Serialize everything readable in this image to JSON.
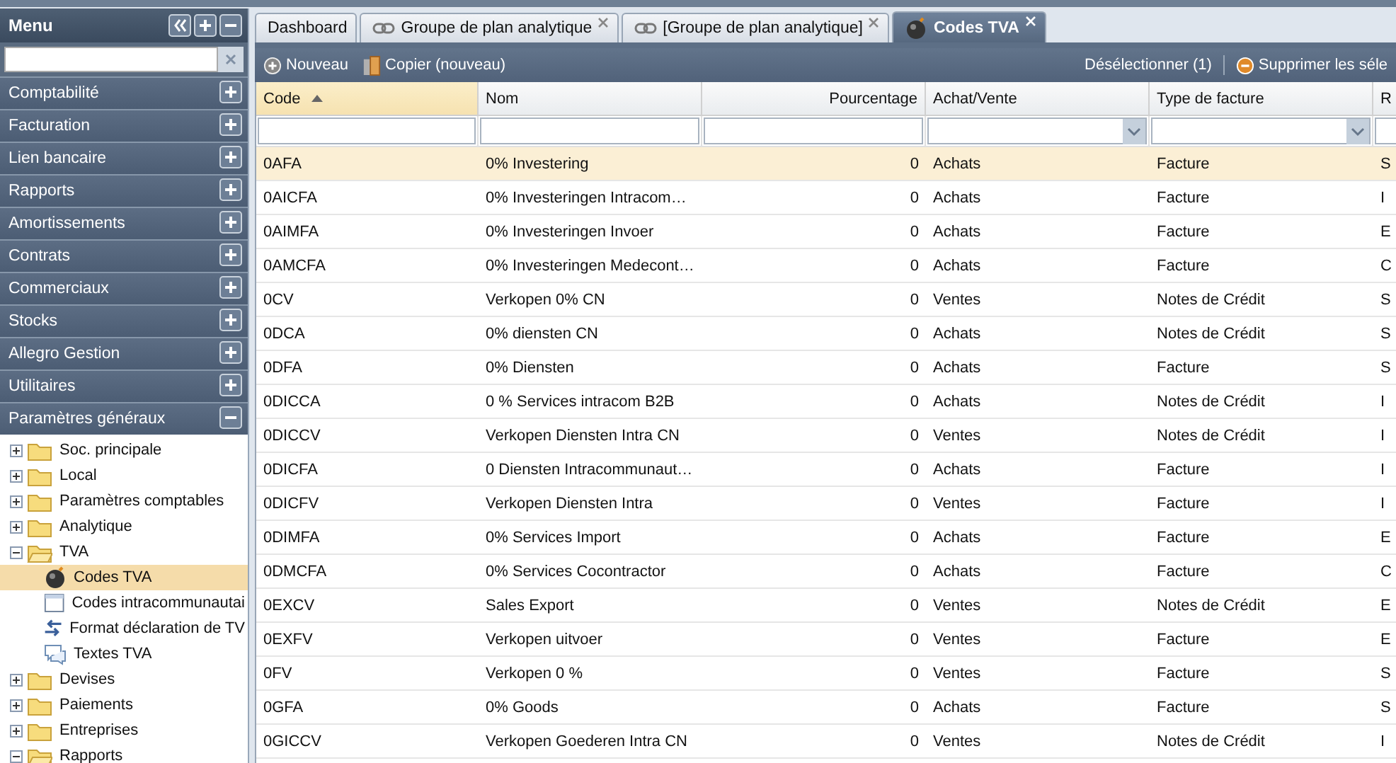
{
  "menu": {
    "title": "Menu",
    "sections": [
      {
        "label": "Comptabilité",
        "expanded": false
      },
      {
        "label": "Facturation",
        "expanded": false
      },
      {
        "label": "Lien bancaire",
        "expanded": false
      },
      {
        "label": "Rapports",
        "expanded": false
      },
      {
        "label": "Amortissements",
        "expanded": false
      },
      {
        "label": "Contrats",
        "expanded": false
      },
      {
        "label": "Commerciaux",
        "expanded": false
      },
      {
        "label": "Stocks",
        "expanded": false
      },
      {
        "label": "Allegro Gestion",
        "expanded": false
      },
      {
        "label": "Utilitaires",
        "expanded": false
      },
      {
        "label": "Paramètres généraux",
        "expanded": true
      }
    ],
    "tree": [
      {
        "label": "Soc. principale",
        "kind": "folder",
        "expanded": false,
        "selected": false
      },
      {
        "label": "Local",
        "kind": "folder",
        "expanded": false,
        "selected": false
      },
      {
        "label": "Paramètres comptables",
        "kind": "folder",
        "expanded": false,
        "selected": false
      },
      {
        "label": "Analytique",
        "kind": "folder",
        "expanded": false,
        "selected": false
      },
      {
        "label": "TVA",
        "kind": "folder",
        "expanded": true,
        "selected": false,
        "children": [
          {
            "label": "Codes TVA",
            "kind": "ball",
            "selected": true
          },
          {
            "label": "Codes intracommunautai",
            "kind": "window",
            "selected": false
          },
          {
            "label": "Format déclaration de TV",
            "kind": "arrows",
            "selected": false
          },
          {
            "label": "Textes TVA",
            "kind": "bubble",
            "selected": false
          }
        ]
      },
      {
        "label": "Devises",
        "kind": "folder",
        "expanded": false,
        "selected": false
      },
      {
        "label": "Paiements",
        "kind": "folder",
        "expanded": false,
        "selected": false
      },
      {
        "label": "Entreprises",
        "kind": "folder",
        "expanded": false,
        "selected": false
      },
      {
        "label": "Rapports",
        "kind": "folder",
        "expanded": true,
        "selected": false
      }
    ]
  },
  "tabs": [
    {
      "label": "Dashboard",
      "kind": "plain",
      "selected": false
    },
    {
      "label": "Groupe de plan analytique",
      "kind": "link",
      "selected": false
    },
    {
      "label": "[Groupe de plan analytique]",
      "kind": "link",
      "selected": false
    },
    {
      "label": "Codes TVA",
      "kind": "ball",
      "selected": true
    }
  ],
  "toolbar": {
    "left": [
      {
        "label": "Nouveau",
        "kind": "add"
      },
      {
        "label": "Copier (nouveau)",
        "kind": "copy"
      }
    ],
    "right": [
      {
        "label": "Désélectionner (1)",
        "kind": "plain"
      },
      {
        "label": "Supprimer les séle",
        "kind": "remove"
      }
    ]
  },
  "table": {
    "columns": [
      {
        "label": "Code",
        "kind": "sorted"
      },
      {
        "label": "Nom",
        "kind": "text"
      },
      {
        "label": "Pourcentage",
        "kind": "number"
      },
      {
        "label": "Achat/Vente",
        "kind": "choice"
      },
      {
        "label": "Type de facture",
        "kind": "choice"
      },
      {
        "label": "R",
        "kind": "text"
      }
    ],
    "rows": [
      {
        "selected": true,
        "cells": [
          "0AFA",
          "0% Investering",
          "0",
          "Achats",
          "Facture",
          "S"
        ]
      },
      {
        "selected": false,
        "cells": [
          "0AICFA",
          "0% Investeringen Intracom…",
          "0",
          "Achats",
          "Facture",
          "I"
        ]
      },
      {
        "selected": false,
        "cells": [
          "0AIMFA",
          "0% Investeringen Invoer",
          "0",
          "Achats",
          "Facture",
          "E"
        ]
      },
      {
        "selected": false,
        "cells": [
          "0AMCFA",
          "0% Investeringen Medecont…",
          "0",
          "Achats",
          "Facture",
          "C"
        ]
      },
      {
        "selected": false,
        "cells": [
          "0CV",
          "Verkopen 0% CN",
          "0",
          "Ventes",
          "Notes de Crédit",
          "S"
        ]
      },
      {
        "selected": false,
        "cells": [
          "0DCA",
          "0% diensten CN",
          "0",
          "Achats",
          "Notes de Crédit",
          "S"
        ]
      },
      {
        "selected": false,
        "cells": [
          "0DFA",
          "0% Diensten",
          "0",
          "Achats",
          "Facture",
          "S"
        ]
      },
      {
        "selected": false,
        "cells": [
          "0DICCA",
          "0 % Services intracom B2B",
          "0",
          "Achats",
          "Notes de Crédit",
          "I"
        ]
      },
      {
        "selected": false,
        "cells": [
          "0DICCV",
          "Verkopen Diensten Intra CN",
          "0",
          "Ventes",
          "Notes de Crédit",
          "I"
        ]
      },
      {
        "selected": false,
        "cells": [
          "0DICFA",
          "0 Diensten Intracommunaut…",
          "0",
          "Achats",
          "Facture",
          "I"
        ]
      },
      {
        "selected": false,
        "cells": [
          "0DICFV",
          "Verkopen Diensten Intra",
          "0",
          "Ventes",
          "Facture",
          "I"
        ]
      },
      {
        "selected": false,
        "cells": [
          "0DIMFA",
          "0% Services Import",
          "0",
          "Achats",
          "Facture",
          "E"
        ]
      },
      {
        "selected": false,
        "cells": [
          "0DMCFA",
          "0% Services Cocontractor",
          "0",
          "Achats",
          "Facture",
          "C"
        ]
      },
      {
        "selected": false,
        "cells": [
          "0EXCV",
          "Sales Export",
          "0",
          "Ventes",
          "Notes de Crédit",
          "E"
        ]
      },
      {
        "selected": false,
        "cells": [
          "0EXFV",
          "Verkopen uitvoer",
          "0",
          "Ventes",
          "Facture",
          "E"
        ]
      },
      {
        "selected": false,
        "cells": [
          "0FV",
          "Verkopen 0 %",
          "0",
          "Ventes",
          "Facture",
          "S"
        ]
      },
      {
        "selected": false,
        "cells": [
          "0GFA",
          "0% Goods",
          "0",
          "Achats",
          "Facture",
          "S"
        ]
      },
      {
        "selected": false,
        "cells": [
          "0GICCV",
          "Verkopen Goederen Intra CN",
          "0",
          "Ventes",
          "Notes de Crédit",
          "I"
        ]
      }
    ]
  }
}
